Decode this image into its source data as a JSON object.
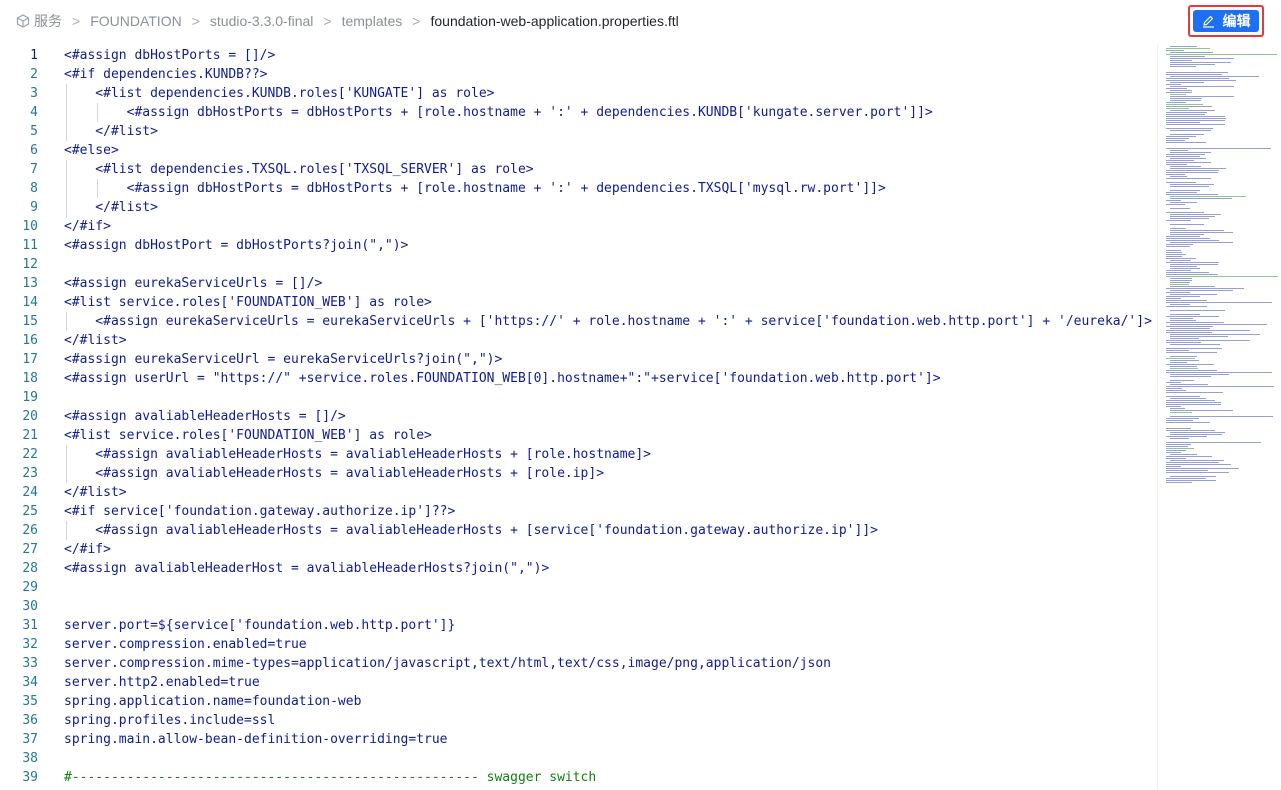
{
  "breadcrumb": {
    "items": [
      "服务",
      "FOUNDATION",
      "studio-3.3.0-final",
      "templates"
    ],
    "current": "foundation-web-application.properties.ftl",
    "separator": ">"
  },
  "toolbar": {
    "edit_label": "编辑",
    "edit_icon": "edit-pen-icon",
    "accent_color": "#1d6ff5",
    "highlight_color": "#e5393c"
  },
  "editor": {
    "active_line": 1,
    "lines": [
      {
        "n": "1",
        "t": "<#assign dbHostPorts = []/>"
      },
      {
        "n": "2",
        "t": "<#if dependencies.KUNDB??>"
      },
      {
        "n": "3",
        "t": "    <#list dependencies.KUNDB.roles['KUNGATE'] as role>"
      },
      {
        "n": "4",
        "t": "        <#assign dbHostPorts = dbHostPorts + [role.hostname + ':' + dependencies.KUNDB['kungate.server.port']]>"
      },
      {
        "n": "5",
        "t": "    </#list>"
      },
      {
        "n": "6",
        "t": "<#else>"
      },
      {
        "n": "7",
        "t": "    <#list dependencies.TXSQL.roles['TXSQL_SERVER'] as role>"
      },
      {
        "n": "8",
        "t": "        <#assign dbHostPorts = dbHostPorts + [role.hostname + ':' + dependencies.TXSQL['mysql.rw.port']]>"
      },
      {
        "n": "9",
        "t": "    </#list>"
      },
      {
        "n": "10",
        "t": "</#if>"
      },
      {
        "n": "11",
        "t": "<#assign dbHostPort = dbHostPorts?join(\",\")>"
      },
      {
        "n": "12",
        "t": ""
      },
      {
        "n": "13",
        "t": "<#assign eurekaServiceUrls = []/>"
      },
      {
        "n": "14",
        "t": "<#list service.roles['FOUNDATION_WEB'] as role>"
      },
      {
        "n": "15",
        "t": "    <#assign eurekaServiceUrls = eurekaServiceUrls + ['https://' + role.hostname + ':' + service['foundation.web.http.port'] + '/eureka/']>"
      },
      {
        "n": "16",
        "t": "</#list>"
      },
      {
        "n": "17",
        "t": "<#assign eurekaServiceUrl = eurekaServiceUrls?join(\",\")>"
      },
      {
        "n": "18",
        "t": "<#assign userUrl = \"https://\" +service.roles.FOUNDATION_WEB[0].hostname+\":\"+service['foundation.web.http.port']>"
      },
      {
        "n": "19",
        "t": ""
      },
      {
        "n": "20",
        "t": "<#assign avaliableHeaderHosts = []/>"
      },
      {
        "n": "21",
        "t": "<#list service.roles['FOUNDATION_WEB'] as role>"
      },
      {
        "n": "22",
        "t": "    <#assign avaliableHeaderHosts = avaliableHeaderHosts + [role.hostname]>"
      },
      {
        "n": "23",
        "t": "    <#assign avaliableHeaderHosts = avaliableHeaderHosts + [role.ip]>"
      },
      {
        "n": "24",
        "t": "</#list>"
      },
      {
        "n": "25",
        "t": "<#if service['foundation.gateway.authorize.ip']??>"
      },
      {
        "n": "26",
        "t": "    <#assign avaliableHeaderHosts = avaliableHeaderHosts + [service['foundation.gateway.authorize.ip']]>"
      },
      {
        "n": "27",
        "t": "</#if>"
      },
      {
        "n": "28",
        "t": "<#assign avaliableHeaderHost = avaliableHeaderHosts?join(\",\")>"
      },
      {
        "n": "29",
        "t": ""
      },
      {
        "n": "30",
        "t": ""
      },
      {
        "n": "31",
        "t": "server.port=${service['foundation.web.http.port']}"
      },
      {
        "n": "32",
        "t": "server.compression.enabled=true"
      },
      {
        "n": "33",
        "t": "server.compression.mime-types=application/javascript,text/html,text/css,image/png,application/json"
      },
      {
        "n": "34",
        "t": "server.http2.enabled=true"
      },
      {
        "n": "35",
        "t": "spring.application.name=foundation-web"
      },
      {
        "n": "36",
        "t": "spring.profiles.include=ssl"
      },
      {
        "n": "37",
        "t": "spring.main.allow-bean-definition-overriding=true"
      },
      {
        "n": "38",
        "t": ""
      },
      {
        "n": "39",
        "t": "#---------------------------------------------------- swagger switch",
        "comment": true
      }
    ]
  },
  "colors": {
    "code_text": "#0f1c8e",
    "comment": "#118011",
    "line_number": "#237893"
  }
}
